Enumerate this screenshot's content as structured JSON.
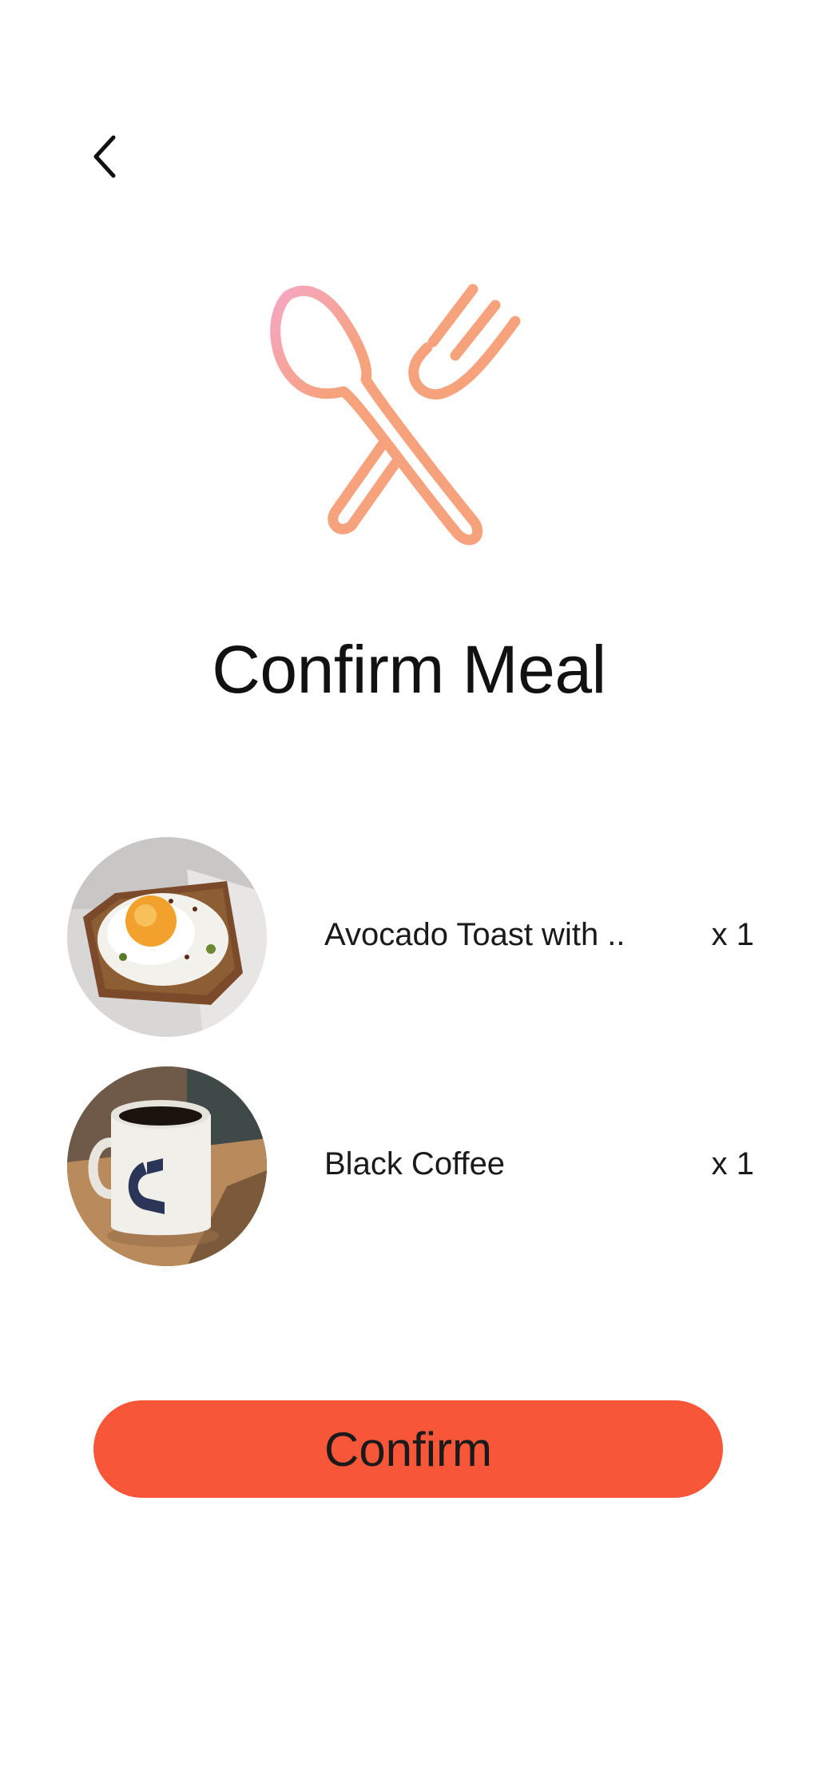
{
  "header": {
    "back_icon": "chevron-left-icon"
  },
  "hero": {
    "icon": "utensils-icon",
    "colors": {
      "primary": "#f6a27c",
      "highlight": "#f5a7c3"
    }
  },
  "title": "Confirm Meal",
  "meal_items": [
    {
      "name": "Avocado Toast with ..",
      "quantity": "x 1",
      "image": "avocado-toast-egg-photo"
    },
    {
      "name": "Black Coffee",
      "quantity": "x 1",
      "image": "black-coffee-mug-photo"
    }
  ],
  "confirm_button": {
    "label": "Confirm",
    "color": "#f85638"
  }
}
